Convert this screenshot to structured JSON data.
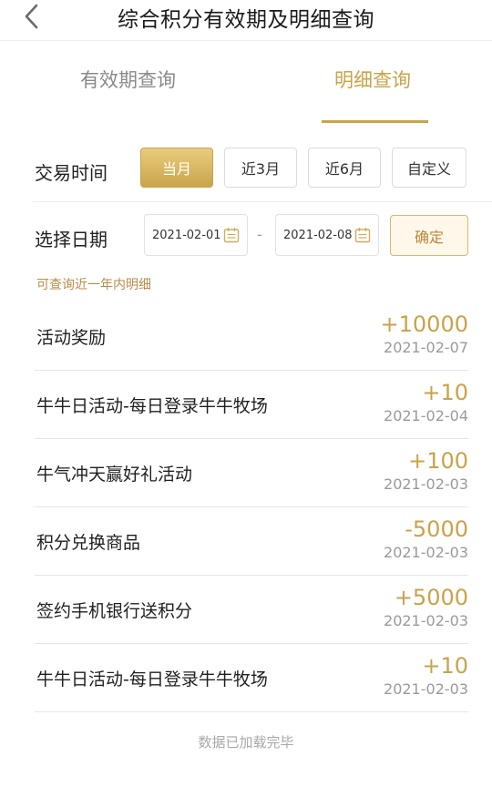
{
  "header": {
    "title": "综合积分有效期及明细查询",
    "back_icon": "chevron-left-icon"
  },
  "tabs": [
    {
      "label": "有效期查询",
      "active": false
    },
    {
      "label": "明细查询",
      "active": true
    }
  ],
  "filters": {
    "time_label": "交易时间",
    "periods": [
      {
        "label": "当月",
        "active": true
      },
      {
        "label": "近3月",
        "active": false
      },
      {
        "label": "近6月",
        "active": false
      },
      {
        "label": "自定义",
        "active": false
      }
    ],
    "date_label": "选择日期",
    "start_date": "2021-02-01",
    "separator": "-",
    "end_date": "2021-02-08",
    "confirm_label": "确定",
    "calendar_icon": "calendar-icon",
    "hint": "可查询近一年内明细"
  },
  "records": [
    {
      "name": "活动奖励",
      "points": "+10000",
      "date": "2021-02-07"
    },
    {
      "name": "牛牛日活动-每日登录牛牛牧场",
      "points": "+10",
      "date": "2021-02-04"
    },
    {
      "name": "牛气冲天赢好礼活动",
      "points": "+100",
      "date": "2021-02-03"
    },
    {
      "name": "积分兑换商品",
      "points": "-5000",
      "date": "2021-02-03"
    },
    {
      "name": "签约手机银行送积分",
      "points": "+5000",
      "date": "2021-02-03"
    },
    {
      "name": "牛牛日活动-每日登录牛牛牧场",
      "points": "+10",
      "date": "2021-02-03"
    }
  ],
  "footer": {
    "end_text": "数据已加载完毕"
  },
  "colors": {
    "accent": "#c8a34a",
    "hint": "#b98c4a"
  }
}
